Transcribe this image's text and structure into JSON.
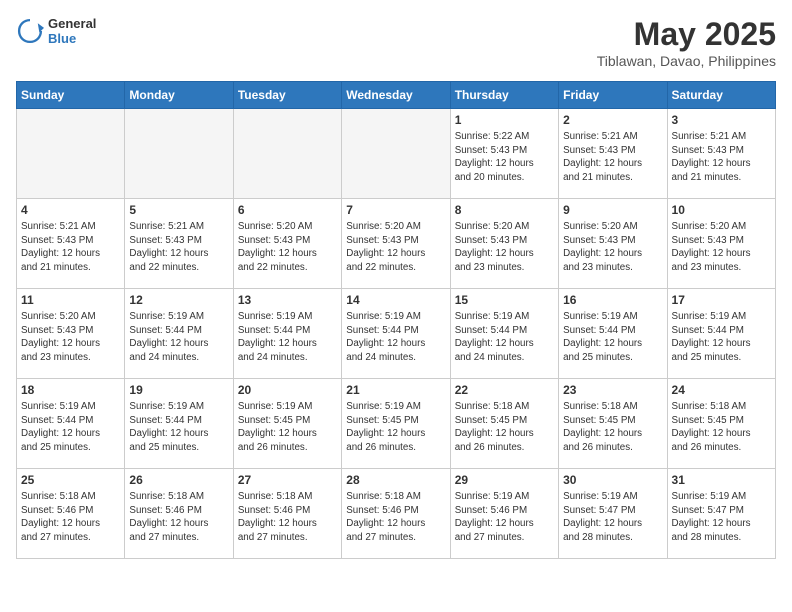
{
  "header": {
    "logo": {
      "line1": "General",
      "line2": "Blue"
    },
    "title": "May 2025",
    "location": "Tiblawan, Davao, Philippines"
  },
  "weekdays": [
    "Sunday",
    "Monday",
    "Tuesday",
    "Wednesday",
    "Thursday",
    "Friday",
    "Saturday"
  ],
  "weeks": [
    [
      {
        "day": "",
        "info": ""
      },
      {
        "day": "",
        "info": ""
      },
      {
        "day": "",
        "info": ""
      },
      {
        "day": "",
        "info": ""
      },
      {
        "day": "1",
        "info": "Sunrise: 5:22 AM\nSunset: 5:43 PM\nDaylight: 12 hours\nand 20 minutes."
      },
      {
        "day": "2",
        "info": "Sunrise: 5:21 AM\nSunset: 5:43 PM\nDaylight: 12 hours\nand 21 minutes."
      },
      {
        "day": "3",
        "info": "Sunrise: 5:21 AM\nSunset: 5:43 PM\nDaylight: 12 hours\nand 21 minutes."
      }
    ],
    [
      {
        "day": "4",
        "info": "Sunrise: 5:21 AM\nSunset: 5:43 PM\nDaylight: 12 hours\nand 21 minutes."
      },
      {
        "day": "5",
        "info": "Sunrise: 5:21 AM\nSunset: 5:43 PM\nDaylight: 12 hours\nand 22 minutes."
      },
      {
        "day": "6",
        "info": "Sunrise: 5:20 AM\nSunset: 5:43 PM\nDaylight: 12 hours\nand 22 minutes."
      },
      {
        "day": "7",
        "info": "Sunrise: 5:20 AM\nSunset: 5:43 PM\nDaylight: 12 hours\nand 22 minutes."
      },
      {
        "day": "8",
        "info": "Sunrise: 5:20 AM\nSunset: 5:43 PM\nDaylight: 12 hours\nand 23 minutes."
      },
      {
        "day": "9",
        "info": "Sunrise: 5:20 AM\nSunset: 5:43 PM\nDaylight: 12 hours\nand 23 minutes."
      },
      {
        "day": "10",
        "info": "Sunrise: 5:20 AM\nSunset: 5:43 PM\nDaylight: 12 hours\nand 23 minutes."
      }
    ],
    [
      {
        "day": "11",
        "info": "Sunrise: 5:20 AM\nSunset: 5:43 PM\nDaylight: 12 hours\nand 23 minutes."
      },
      {
        "day": "12",
        "info": "Sunrise: 5:19 AM\nSunset: 5:44 PM\nDaylight: 12 hours\nand 24 minutes."
      },
      {
        "day": "13",
        "info": "Sunrise: 5:19 AM\nSunset: 5:44 PM\nDaylight: 12 hours\nand 24 minutes."
      },
      {
        "day": "14",
        "info": "Sunrise: 5:19 AM\nSunset: 5:44 PM\nDaylight: 12 hours\nand 24 minutes."
      },
      {
        "day": "15",
        "info": "Sunrise: 5:19 AM\nSunset: 5:44 PM\nDaylight: 12 hours\nand 24 minutes."
      },
      {
        "day": "16",
        "info": "Sunrise: 5:19 AM\nSunset: 5:44 PM\nDaylight: 12 hours\nand 25 minutes."
      },
      {
        "day": "17",
        "info": "Sunrise: 5:19 AM\nSunset: 5:44 PM\nDaylight: 12 hours\nand 25 minutes."
      }
    ],
    [
      {
        "day": "18",
        "info": "Sunrise: 5:19 AM\nSunset: 5:44 PM\nDaylight: 12 hours\nand 25 minutes."
      },
      {
        "day": "19",
        "info": "Sunrise: 5:19 AM\nSunset: 5:44 PM\nDaylight: 12 hours\nand 25 minutes."
      },
      {
        "day": "20",
        "info": "Sunrise: 5:19 AM\nSunset: 5:45 PM\nDaylight: 12 hours\nand 26 minutes."
      },
      {
        "day": "21",
        "info": "Sunrise: 5:19 AM\nSunset: 5:45 PM\nDaylight: 12 hours\nand 26 minutes."
      },
      {
        "day": "22",
        "info": "Sunrise: 5:18 AM\nSunset: 5:45 PM\nDaylight: 12 hours\nand 26 minutes."
      },
      {
        "day": "23",
        "info": "Sunrise: 5:18 AM\nSunset: 5:45 PM\nDaylight: 12 hours\nand 26 minutes."
      },
      {
        "day": "24",
        "info": "Sunrise: 5:18 AM\nSunset: 5:45 PM\nDaylight: 12 hours\nand 26 minutes."
      }
    ],
    [
      {
        "day": "25",
        "info": "Sunrise: 5:18 AM\nSunset: 5:46 PM\nDaylight: 12 hours\nand 27 minutes."
      },
      {
        "day": "26",
        "info": "Sunrise: 5:18 AM\nSunset: 5:46 PM\nDaylight: 12 hours\nand 27 minutes."
      },
      {
        "day": "27",
        "info": "Sunrise: 5:18 AM\nSunset: 5:46 PM\nDaylight: 12 hours\nand 27 minutes."
      },
      {
        "day": "28",
        "info": "Sunrise: 5:18 AM\nSunset: 5:46 PM\nDaylight: 12 hours\nand 27 minutes."
      },
      {
        "day": "29",
        "info": "Sunrise: 5:19 AM\nSunset: 5:46 PM\nDaylight: 12 hours\nand 27 minutes."
      },
      {
        "day": "30",
        "info": "Sunrise: 5:19 AM\nSunset: 5:47 PM\nDaylight: 12 hours\nand 28 minutes."
      },
      {
        "day": "31",
        "info": "Sunrise: 5:19 AM\nSunset: 5:47 PM\nDaylight: 12 hours\nand 28 minutes."
      }
    ]
  ]
}
